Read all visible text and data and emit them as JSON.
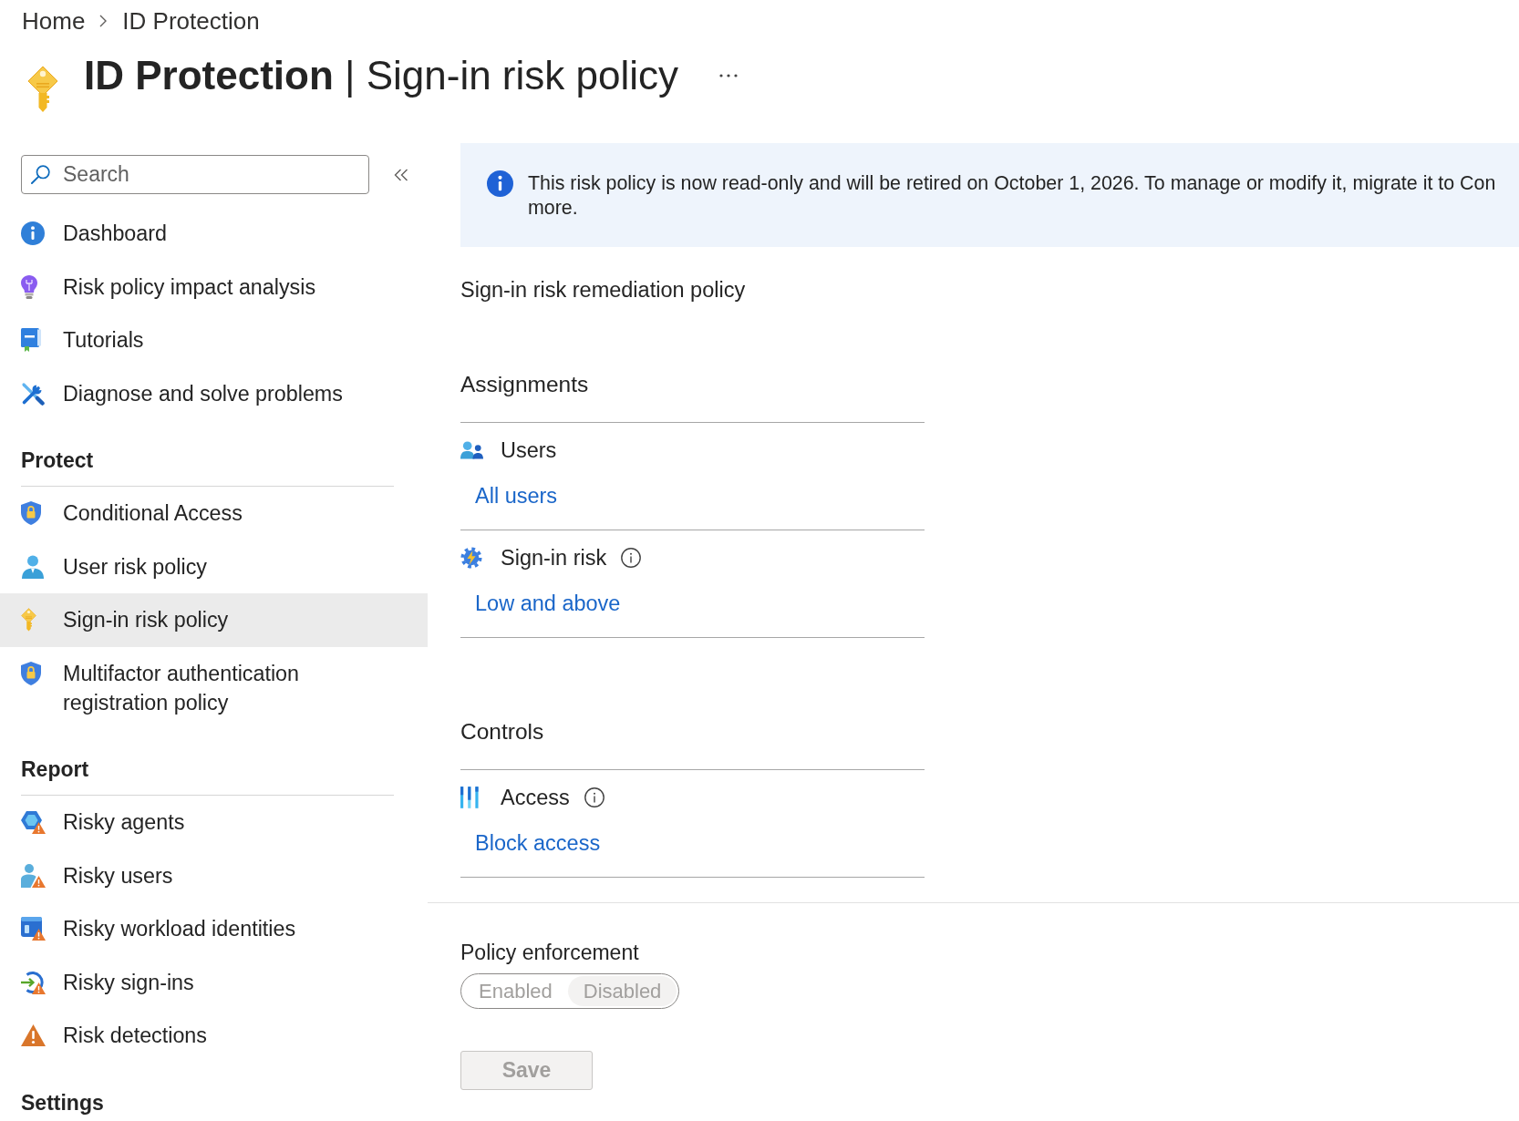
{
  "breadcrumb": [
    "Home",
    "ID Protection"
  ],
  "page_title": "**ID Protection** | Sign-in risk policy",
  "sidebar": {
    "search": {
      "placeholder": "Search"
    },
    "groups": [
      {
        "items": [
          {
            "label": "Dashboard",
            "selected": false
          },
          {
            "label": "Risk policy impact analysis",
            "selected": false
          },
          {
            "label": "Tutorials",
            "selected": false
          },
          {
            "label": "Diagnose and solve problems",
            "selected": false
          }
        ]
      },
      {
        "title": "Protect",
        "items": [
          {
            "label": "Conditional Access",
            "selected": false
          },
          {
            "label": "User risk policy",
            "selected": false
          },
          {
            "label": "Sign-in risk policy",
            "selected": true
          },
          {
            "label": "Multifactor authentication registration policy",
            "selected": false
          }
        ]
      },
      {
        "title": "Report",
        "items": [
          {
            "label": "Risky agents",
            "selected": false
          },
          {
            "label": "Risky users",
            "selected": false
          },
          {
            "label": "Risky workload identities",
            "selected": false
          },
          {
            "label": "Risky sign-ins",
            "selected": false
          },
          {
            "label": "Risk detections",
            "selected": false
          }
        ]
      },
      {
        "title": "Settings"
      }
    ]
  },
  "banner": {
    "lines": [
      "This risk policy is now read-only and will be retired on October 1, 2026. To manage or modify it, migrate it to Con",
      "more."
    ]
  },
  "policy_name": "Sign-in risk remediation policy",
  "sections": [
    {
      "title": "Assignments",
      "rows": [
        {
          "label": "Users",
          "info": false,
          "value": "All users"
        },
        {
          "label": "Sign-in risk",
          "info": true,
          "value": "Low and above"
        }
      ]
    },
    {
      "title": "Controls",
      "rows": [
        {
          "label": "Access",
          "info": true,
          "value": "Block access"
        }
      ]
    }
  ],
  "policy_enforcement": {
    "label": "Policy enforcement",
    "disabled": true,
    "options": [
      {
        "label": "Enabled",
        "selected": false
      },
      {
        "label": "Disabled",
        "selected": true
      }
    ]
  },
  "save_button": {
    "label": "Save",
    "disabled": true
  }
}
